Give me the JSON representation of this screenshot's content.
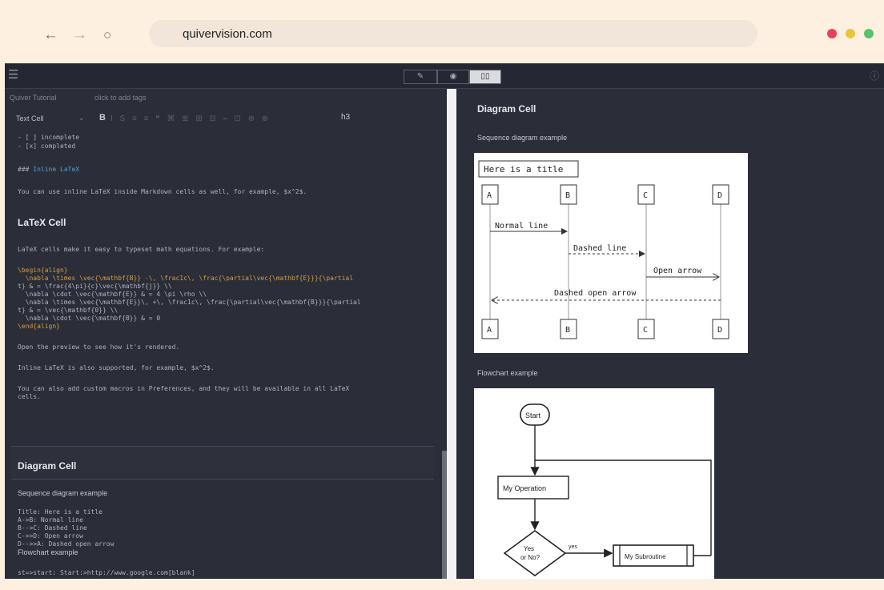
{
  "browser": {
    "url": "quivervision.com",
    "dots": [
      "#e9415b",
      "#e9c53c",
      "#55c46a"
    ]
  },
  "app_toolbar": {
    "modes": [
      "edit",
      "preview",
      "split"
    ],
    "active_mode": "split"
  },
  "editor": {
    "note_title": "Quiver Tutorial",
    "add_tags": "click to add tags",
    "cell_type": "Text Cell",
    "bold_label": "B",
    "heading_label": "h3",
    "lines": {
      "incomplete": "- [ ] incomplete",
      "completed": "- [x] completed",
      "inline_latex_heading_prefix": "###",
      "inline_latex_heading": "Inline LaTeX",
      "inline_latex_text": "You can use inline LaTeX inside Markdown cells as well, for example, $x^2$.",
      "latex_cell_heading": "LaTeX Cell",
      "latex_intro": "LaTeX cells make it easy to typeset math equations. For example:",
      "latex_begin": "\\begin{align}",
      "latex_1": "  \\nabla \\times \\vec{\\mathbf{B}} -\\, \\frac1c\\, \\frac{\\partial\\vec{\\mathbf{E}}}{\\partial",
      "latex_2": "t} & = \\frac{4\\pi}{c}\\vec{\\mathbf{j}} \\\\",
      "latex_3": "  \\nabla \\cdot \\vec{\\mathbf{E}} & = 4 \\pi \\rho \\\\",
      "latex_4": "  \\nabla \\times \\vec{\\mathbf{E}}\\, +\\, \\frac1c\\, \\frac{\\partial\\vec{\\mathbf{B}}}{\\partial",
      "latex_5": "t} & = \\vec{\\mathbf{0}} \\\\",
      "latex_6": "  \\nabla \\cdot \\vec{\\mathbf{B}} & = 0",
      "latex_end": "\\end{align}",
      "preview_hint": "Open the preview to see how it's rendered.",
      "inline_supported": "Inline LaTeX is also supported, for example, $x^2$.",
      "macros_1": "You can also add custom macros in Preferences, and they will be available in all LaTeX",
      "macros_2": "cells.",
      "diagram_cell_heading": "Diagram Cell",
      "seq_example": "Sequence diagram example",
      "seq_1": "Title: Here is a title",
      "seq_2": "A->B: Normal line",
      "seq_3": "B-->C: Dashed line",
      "seq_4": "C->>D: Open arrow",
      "seq_5": "D-->>A: Dashed open arrow",
      "flow_example": "Flowchart example",
      "flow_1": "st=>start: Start:>http://www.google.com[blank]"
    }
  },
  "preview": {
    "heading": "Diagram Cell",
    "seq_caption": "Sequence diagram example",
    "flow_caption": "Flowchart example",
    "sequence": {
      "title": "Here is a title",
      "actors": [
        "A",
        "B",
        "C",
        "D"
      ],
      "messages": [
        "Normal line",
        "Dashed line",
        "Open arrow",
        "Dashed open arrow"
      ]
    },
    "flowchart": {
      "start": "Start",
      "operation": "My Operation",
      "condition_1": "Yes",
      "condition_2": "or No?",
      "yes_label": "yes",
      "subroutine": "My Subroutine"
    }
  }
}
